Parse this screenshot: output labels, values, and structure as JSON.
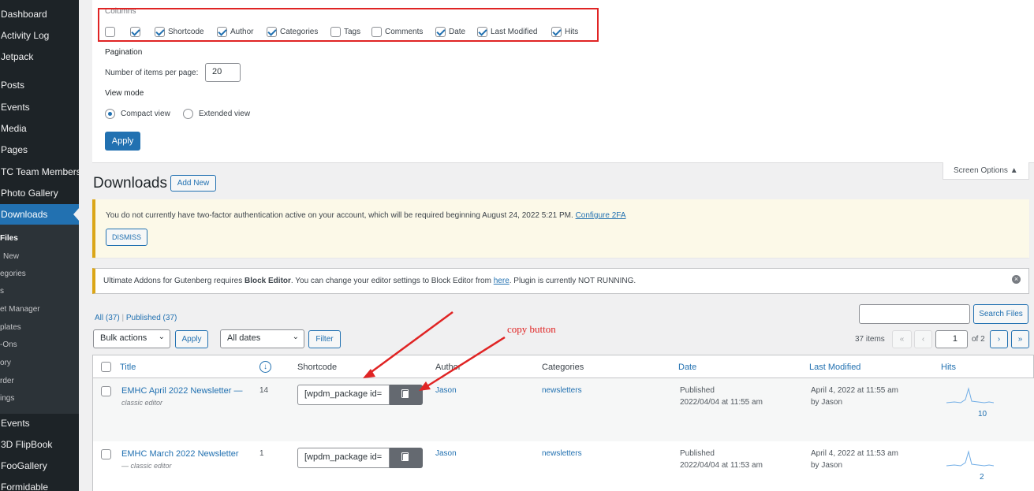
{
  "sidebar": {
    "items": [
      {
        "label": "Dashboard"
      },
      {
        "label": "Activity Log"
      },
      {
        "label": "Jetpack"
      },
      {
        "label": "Posts"
      },
      {
        "label": "Events"
      },
      {
        "label": "Media"
      },
      {
        "label": "Pages"
      },
      {
        "label": "TC Team Members"
      },
      {
        "label": "Photo Gallery"
      },
      {
        "label": "Downloads"
      }
    ],
    "sub_items": [
      {
        "label": "Files"
      },
      {
        "label": "New"
      },
      {
        "label": "egories"
      },
      {
        "label": "s"
      },
      {
        "label": "et Manager"
      },
      {
        "label": "plates"
      },
      {
        "label": "-Ons"
      },
      {
        "label": "ory"
      },
      {
        "label": "rder"
      },
      {
        "label": "ings"
      }
    ],
    "bottom_items": [
      {
        "label": "Events"
      },
      {
        "label": "3D FlipBook"
      },
      {
        "label": "FooGallery"
      },
      {
        "label": "Formidable"
      }
    ]
  },
  "screen_options": {
    "columns_heading": "Columns",
    "columns": [
      {
        "label": "",
        "checked": false
      },
      {
        "label": "",
        "checked": true
      },
      {
        "label": "Shortcode",
        "checked": true
      },
      {
        "label": "Author",
        "checked": true
      },
      {
        "label": "Categories",
        "checked": true
      },
      {
        "label": "Tags",
        "checked": false
      },
      {
        "label": "Comments",
        "checked": false
      },
      {
        "label": "Date",
        "checked": true
      },
      {
        "label": "Last Modified",
        "checked": true
      },
      {
        "label": "Hits",
        "checked": true
      }
    ],
    "pagination_heading": "Pagination",
    "items_per_page_label": "Number of items per page:",
    "items_per_page_value": "20",
    "view_mode_heading": "View mode",
    "compact_view": "Compact view",
    "extended_view": "Extended view",
    "apply": "Apply",
    "tab_label": "Screen Options ▲"
  },
  "heading": {
    "title": "Downloads",
    "add_new": "Add New"
  },
  "notices": {
    "twofa_text": "You do not currently have two-factor authentication active on your account, which will be required beginning August 24, 2022 5:21 PM.",
    "twofa_link": "Configure 2FA",
    "dismiss": "DISMISS",
    "gutenberg_pre": "Ultimate Addons for Gutenberg requires",
    "gutenberg_bold": "Block Editor",
    "gutenberg_mid": ". You can change your editor settings to Block Editor from",
    "gutenberg_link": "here",
    "gutenberg_post": ". Plugin is currently NOT RUNNING.",
    "close_icon": "×"
  },
  "filters": {
    "all": "All (37)",
    "sep": "|",
    "published": "Published (37)",
    "bulk_actions": "Bulk actions",
    "apply": "Apply",
    "all_dates": "All dates",
    "filter": "Filter",
    "search_button": "Search Files",
    "items_count": "37 items",
    "first": "«",
    "prev": "‹",
    "page": "1",
    "of_pages": "of 2",
    "next": "›",
    "last": "»"
  },
  "table": {
    "headers": {
      "title": "Title",
      "shortcode": "Shortcode",
      "author": "Author",
      "categories": "Categories",
      "date": "Date",
      "last_modified": "Last Modified",
      "hits": "Hits"
    },
    "rows": [
      {
        "title": "EMHC April 2022 Newsletter —",
        "editor": "classic editor",
        "count": "14",
        "shortcode": "[wpdm_package id=",
        "author": "Jason",
        "category": "newsletters",
        "date_status": "Published",
        "date": "2022/04/04 at 11:55 am",
        "modified": "April 4, 2022 at 11:55 am",
        "modified_by": "by Jason",
        "hits": "10"
      },
      {
        "title": "EMHC March 2022 Newsletter",
        "editor": "— classic editor",
        "count": "1",
        "shortcode": "[wpdm_package id=",
        "author": "Jason",
        "category": "newsletters",
        "date_status": "Published",
        "date": "2022/04/04 at 11:53 am",
        "modified": "April 4, 2022 at 11:53 am",
        "modified_by": "by Jason",
        "hits": "2"
      }
    ]
  },
  "annotation": {
    "copy_label": "copy button"
  }
}
